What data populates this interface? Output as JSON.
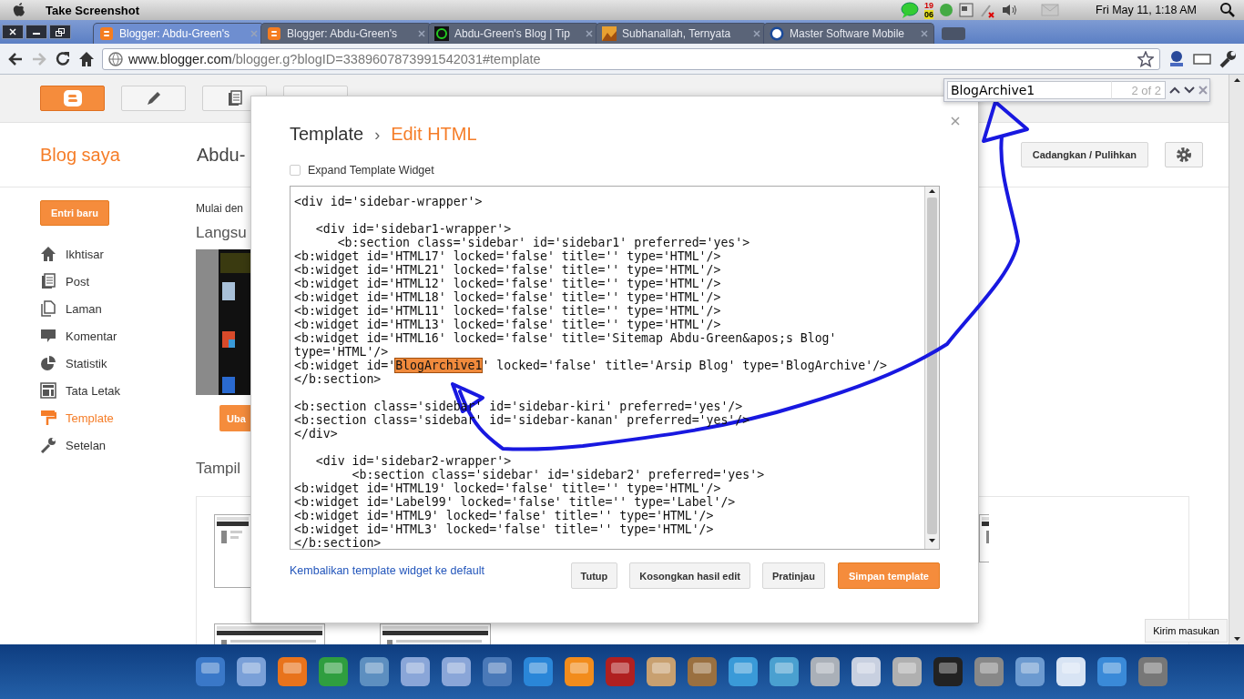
{
  "menubar": {
    "app_title": "Take Screenshot",
    "tray_badges": [
      "19",
      "06"
    ],
    "clock": "Fri May 11, 1:18 AM"
  },
  "tabs": [
    {
      "title": "Blogger: Abdu-Green's",
      "selected": true
    },
    {
      "title": "Blogger: Abdu-Green's",
      "selected": false
    },
    {
      "title": "Abdu-Green's Blog | Tip",
      "selected": false
    },
    {
      "title": "Subhanallah, Ternyata",
      "selected": false
    },
    {
      "title": "Master Software Mobile",
      "selected": false
    }
  ],
  "address_bar": {
    "host": "www.blogger.com",
    "path": "/blogger.g?blogID=3389607873991542031#template"
  },
  "find_bar": {
    "value": "BlogArchive1",
    "count": "2 of 2"
  },
  "blogger": {
    "header_title": "Blog saya",
    "blog_name": "Abdu-",
    "backup_button": "Cadangkan / Pulihkan",
    "new_post": "Entri baru",
    "nav": [
      {
        "label": "Ikhtisar",
        "selected": false
      },
      {
        "label": "Post",
        "selected": false
      },
      {
        "label": "Laman",
        "selected": false
      },
      {
        "label": "Komentar",
        "selected": false
      },
      {
        "label": "Statistik",
        "selected": false
      },
      {
        "label": "Tata Letak",
        "selected": false
      },
      {
        "label": "Template",
        "selected": true
      },
      {
        "label": "Setelan",
        "selected": false
      }
    ],
    "main": {
      "intro": "Mulai den",
      "heading": "Langsu",
      "button": "Uba",
      "section": "Tampil"
    },
    "feedback": "Kirim masukan"
  },
  "dialog": {
    "breadcrumb": "Template",
    "separator": "›",
    "title": "Edit HTML",
    "expand": {
      "label": "Expand Template Widget",
      "checked": false
    },
    "code_lines": [
      {
        "text": "<div id='sidebar-wrapper'>"
      },
      {
        "text": "   <div id='sidebar1-wrapper'>",
        "space_before": true
      },
      {
        "text": "      <b:section class='sidebar' id='sidebar1' preferred='yes'>"
      },
      {
        "text": "<b:widget id='HTML17' locked='false' title='' type='HTML'/>"
      },
      {
        "text": "<b:widget id='HTML21' locked='false' title='' type='HTML'/>"
      },
      {
        "text": "<b:widget id='HTML12' locked='false' title='' type='HTML'/>"
      },
      {
        "text": "<b:widget id='HTML18' locked='false' title='' type='HTML'/>"
      },
      {
        "text": "<b:widget id='HTML11' locked='false' title='' type='HTML'/>"
      },
      {
        "text": "<b:widget id='HTML13' locked='false' title='' type='HTML'/>"
      },
      {
        "text": "<b:widget id='HTML16' locked='false' title='Sitemap Abdu-Green&apos;s Blog'"
      },
      {
        "text": "type='HTML'/>"
      },
      {
        "parts": [
          {
            "text": "<b:widget id='",
            "highlighted": false
          },
          {
            "text": "BlogArchive1",
            "highlighted": true
          },
          {
            "text": "' locked='false' title='Arsip Blog' type='BlogArchive'/>",
            "highlighted": false
          }
        ]
      },
      {
        "text": "</b:section>"
      },
      {
        "text": "<b:section class='sidebar' id='sidebar-kiri' preferred='yes'/>",
        "space_before": true
      },
      {
        "text": "<b:section class='sidebar' id='sidebar-kanan' preferred='yes'/>"
      },
      {
        "text": "</div>"
      },
      {
        "text": "   <div id='sidebar2-wrapper'>",
        "space_before": true
      },
      {
        "text": "        <b:section class='sidebar' id='sidebar2' preferred='yes'>"
      },
      {
        "text": "<b:widget id='HTML19' locked='false' title='' type='HTML'/>"
      },
      {
        "text": "<b:widget id='Label99' locked='false' title='' type='Label'/>"
      },
      {
        "text": "<b:widget id='HTML9' locked='false' title='' type='HTML'/>"
      },
      {
        "text": "<b:widget id='HTML3' locked='false' title='' type='HTML'/>"
      },
      {
        "text": "</b:section>"
      }
    ],
    "reset_link": "Kembalikan template widget ke default",
    "buttons": [
      {
        "label": "Tutup",
        "kind": "default"
      },
      {
        "label": "Kosongkan hasil edit",
        "kind": "default"
      },
      {
        "label": "Pratinjau",
        "kind": "default"
      },
      {
        "label": "Simpan template",
        "kind": "primary"
      }
    ]
  }
}
